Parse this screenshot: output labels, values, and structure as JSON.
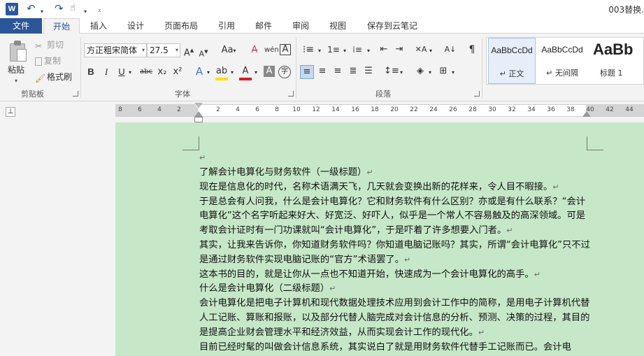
{
  "titlebar": {
    "app_icon": "word-icon",
    "doc_title": "003替换."
  },
  "tabs": [
    "文件",
    "开始",
    "插入",
    "设计",
    "页面布局",
    "引用",
    "邮件",
    "审阅",
    "视图",
    "保存到云笔记"
  ],
  "clipboard": {
    "paste": "粘贴",
    "cut": "剪切",
    "copy": "复制",
    "format_painter": "格式刷",
    "group": "剪贴板"
  },
  "font": {
    "name": "方正粗宋简体",
    "size": "27.5",
    "group": "字体",
    "bold": "B",
    "italic": "I",
    "underline": "U",
    "strike": "abc",
    "subscript": "x₂",
    "superscript": "x²",
    "change_case": "Aa",
    "grow": "A",
    "shrink": "A"
  },
  "paragraph": {
    "group": "段落"
  },
  "styles": {
    "items": [
      {
        "sample": "AaBbCcDd",
        "name": "↵ 正文"
      },
      {
        "sample": "AaBbCcDd",
        "name": "↵ 无间隔"
      },
      {
        "sample": "AaBb",
        "name": "标题 1"
      }
    ]
  },
  "ruler": {
    "labels": [
      "8",
      "6",
      "4",
      "2",
      "2",
      "4",
      "6",
      "8",
      "10",
      "12",
      "14",
      "16",
      "18",
      "20",
      "22",
      "24",
      "26",
      "28",
      "30",
      "32",
      "34",
      "36",
      "38",
      "40",
      "42",
      "44"
    ]
  },
  "document": {
    "paragraphs": [
      "了解会计电算化与财务软件（一级标题）",
      "现在是信息化的时代，名称术语满天飞，几天就会变换出新的花样来，令人目不暇接。",
      "于是总会有人问我，什么是会计电算化？它和财务软件有什么区别？亦或是有什么联系？“会计电算化”这个名字听起来好大、好宽泛、好吓人，似乎是一个常人不容易触及的高深领域。可是考取会计证时有一门功课就叫“会计电算化”，于是吓着了许多想要入门者。",
      "其实，让我来告诉你，你知道财务软件吗？你知道电脑记账吗？其实，所谓“会计电算化”只不过是通过财务软件实现电脑记账的“官方”术语罢了。",
      "这本书的目的，就是让你从一点也不知道开始，快速成为一个会计电算化的高手。",
      "什么是会计电算化（二级标题）",
      "会计电算化是把电子计算机和现代数据处理技术应用到会计工作中的简称，是用电子计算机代替人工记账、算账和报账，以及部分代替人脑完成对会计信息的分析、预测、决策的过程，其目的是提高企业财会管理水平和经济效益，从而实现会计工作的现代化。",
      "目前已经时髦的叫做会计信息系统，其实说白了就是用财务软件代替手工记账而已。会计电"
    ]
  }
}
